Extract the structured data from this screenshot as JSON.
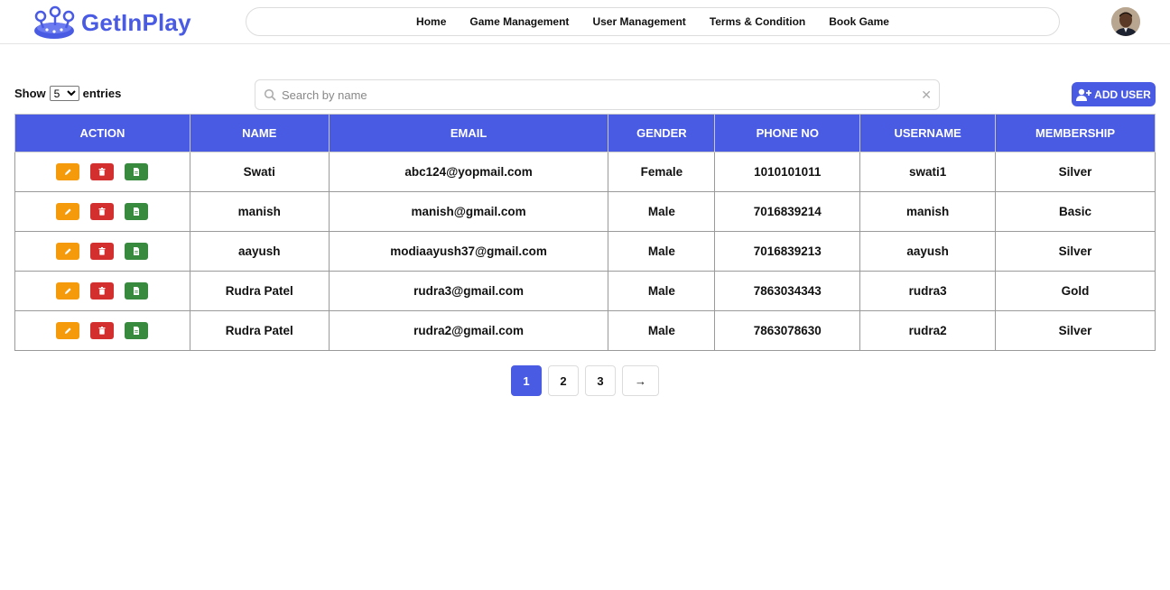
{
  "app": {
    "logo_text": "GetInPlay"
  },
  "nav": {
    "items": [
      {
        "label": "Home"
      },
      {
        "label": "Game Management"
      },
      {
        "label": "User Management"
      },
      {
        "label": "Terms & Condition"
      },
      {
        "label": "Book Game"
      }
    ]
  },
  "controls": {
    "show_label": "Show",
    "entries_value": "5",
    "entries_label": "entries",
    "search_placeholder": "Search by name",
    "search_value": "",
    "add_user_label": "ADD USER"
  },
  "table": {
    "headers": [
      "ACTION",
      "NAME",
      "EMAIL",
      "GENDER",
      "PHONE NO",
      "USERNAME",
      "MEMBERSHIP"
    ],
    "rows": [
      {
        "name": "Swati",
        "email": "abc124@yopmail.com",
        "gender": "Female",
        "phone": "1010101011",
        "username": "swati1",
        "membership": "Silver"
      },
      {
        "name": "manish",
        "email": "manish@gmail.com",
        "gender": "Male",
        "phone": "7016839214",
        "username": "manish",
        "membership": "Basic"
      },
      {
        "name": "aayush",
        "email": "modiaayush37@gmail.com",
        "gender": "Male",
        "phone": "7016839213",
        "username": "aayush",
        "membership": "Silver"
      },
      {
        "name": "Rudra Patel",
        "email": "rudra3@gmail.com",
        "gender": "Male",
        "phone": "7863034343",
        "username": "rudra3",
        "membership": "Gold"
      },
      {
        "name": "Rudra Patel",
        "email": "rudra2@gmail.com",
        "gender": "Male",
        "phone": "7863078630",
        "username": "rudra2",
        "membership": "Silver"
      }
    ]
  },
  "pagination": {
    "pages": [
      "1",
      "2",
      "3"
    ],
    "active": "1",
    "next_symbol": "→"
  },
  "colors": {
    "brand": "#4a5be3",
    "edit": "#f59a0a",
    "delete": "#d42f2f",
    "document": "#378a3e"
  },
  "icons": {
    "edit": "pencil-icon",
    "delete": "trash-icon",
    "document": "document-icon",
    "search": "search-icon",
    "clear": "close-icon",
    "add_user": "add-user-icon"
  }
}
